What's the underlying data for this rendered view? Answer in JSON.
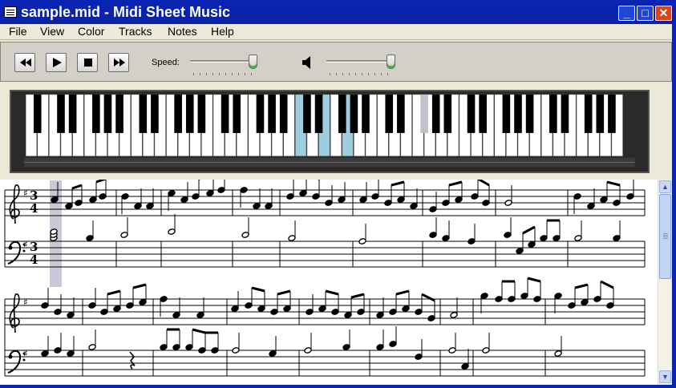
{
  "window": {
    "title": "sample.mid - Midi Sheet Music",
    "controls": {
      "minimize": "_",
      "maximize": "□",
      "close": "✕"
    }
  },
  "menu": [
    "File",
    "View",
    "Color",
    "Tracks",
    "Notes",
    "Help"
  ],
  "toolbar": {
    "buttons": [
      "rewind-icon",
      "play-icon",
      "stop-icon",
      "fast-forward-icon"
    ],
    "speed_label": "Speed:",
    "volume_icon": "speaker-icon",
    "speed_level": 1.0,
    "volume_level": 1.0
  },
  "piano": {
    "highlight_color": "#9ecde0",
    "secondary_color": "#c4bfcf",
    "highlighted_white_keys": [
      23,
      25,
      27
    ],
    "highlighted_black_keys": [
      33
    ]
  },
  "sheet": {
    "key_signature": "G major",
    "time_signature": "3/4",
    "playhead_color": "#cbc6d8"
  },
  "colors": {
    "titlebar": "#0a24b4",
    "chrome": "#ece9d8",
    "toolbar": "#d4d0c8"
  }
}
